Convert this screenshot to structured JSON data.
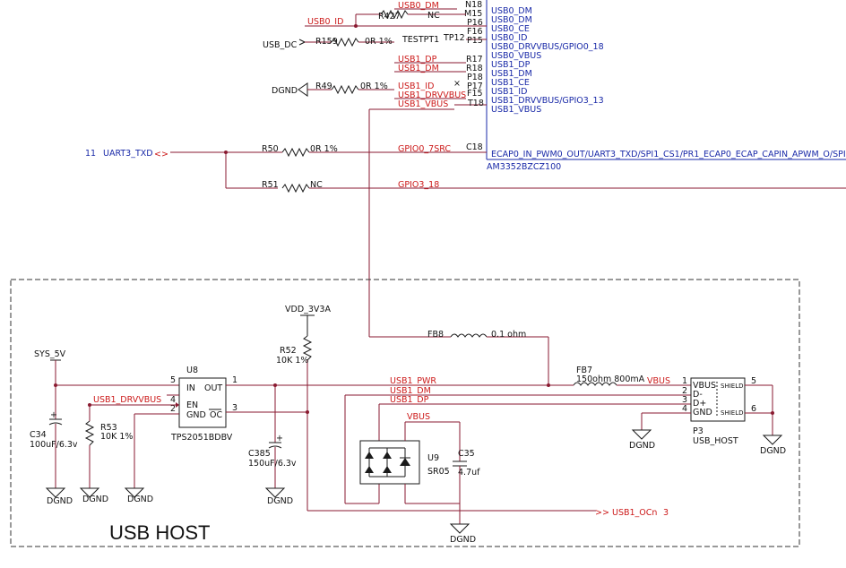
{
  "soc": {
    "pins_top": [
      "N18",
      "M15",
      "P16",
      "F16",
      "TESTPT1",
      "TP12",
      "P15",
      "R17",
      "R18",
      "P18",
      "P17",
      "F15",
      "T18"
    ],
    "signals_top": [
      "USB0_DM",
      "USB0_DM",
      "USB0_CE",
      "USB0_ID",
      "USB0_DRVVBUS/GPIO0_18",
      "USB0_VBUS",
      "USB1_DP",
      "USB1_DM",
      "USB1_CE",
      "USB1_ID",
      "USB1_DRVVBUS/GPIO3_13",
      "USB1_VBUS"
    ],
    "pin_c18": "C18",
    "func_c18": "ECAP0_IN_PWM0_OUT/UART3_TXD/SPI1_CS1/PR1_ECAP0_ECAP_CAPIN_APWM_O/SPI1_S",
    "part": "AM3352BZCZ100"
  },
  "nets": {
    "usb0_dm": "USB0_DM",
    "usb0_id": "USB0_ID",
    "usb_dc": "USB_DC",
    "usb1_dp": "USB1_DP",
    "usb1_dm": "USB1_DM",
    "usb1_id": "USB1_ID",
    "usb1_drvvbus": "USB1_DRVVBUS",
    "usb1_vbus": "USB1_VBUS",
    "gpio0_7src": "GPIO0_7SRC",
    "gpio3_18": "GPIO3_18",
    "uart3_num": "11",
    "uart3_txd": "UART3_TXD",
    "dgnd": "DGND",
    "vdd": "VDD_3V3A",
    "sys5v": "SYS_5V",
    "usb1_drvvbus_b": "USB1_DRVVBUS",
    "usb1_pwr": "USB1_PWR",
    "usb1_dm_b": "USB1_DM",
    "usb1_dp_b": "USB1_DP",
    "vbus": "VBUS",
    "vbus2": "VBUS",
    "usb1_ocn": "USB1_OCn",
    "usb1_ocn_num": "3"
  },
  "parts": {
    "r427": {
      "ref": "R427",
      "val": "NC"
    },
    "r159": {
      "ref": "R159",
      "val": "0R 1%"
    },
    "r49": {
      "ref": "R49",
      "val": "0R 1%"
    },
    "r50": {
      "ref": "R50",
      "val": "0R 1%"
    },
    "r51": {
      "ref": "R51",
      "val": "NC"
    },
    "fb8": {
      "ref": "FB8",
      "val": "0.1 ohm"
    },
    "r52": {
      "ref": "R52",
      "val": "10K 1%"
    },
    "u8": {
      "ref": "U8",
      "part": "TPS2051BDBV",
      "in": "IN",
      "out": "OUT",
      "en": "EN",
      "gnd": "GND",
      "oc": "OC",
      "p1": "1",
      "p2": "2",
      "p3": "3",
      "p4": "4",
      "p5": "5"
    },
    "fb7": {
      "ref": "FB7",
      "val": "150ohm 800mA"
    },
    "p3": {
      "ref": "P3",
      "part": "USB_HOST",
      "vbus": "VBUS",
      "dm": "D-",
      "dp": "D+",
      "gnd": "GND",
      "shield": "SHIELD",
      "p1": "1",
      "p2": "2",
      "p3": "3",
      "p4": "4",
      "p5": "5",
      "p6": "6"
    },
    "c34": {
      "ref": "C34",
      "val": "100uF/6.3v"
    },
    "r53": {
      "ref": "R53",
      "val": "10K 1%"
    },
    "c385": {
      "ref": "C385",
      "val": "150uF/6.3v"
    },
    "u9": {
      "ref": "U9",
      "part": "SR05"
    },
    "c35": {
      "ref": "C35",
      "val": "4.7uf"
    }
  },
  "block_title": "USB HOST",
  "colors": {
    "wire": "#8a1a30",
    "net_label": "#cc1a1a",
    "pin_text": "#1a2aa8",
    "component": "#1a1a1a",
    "frame": "#333333"
  }
}
